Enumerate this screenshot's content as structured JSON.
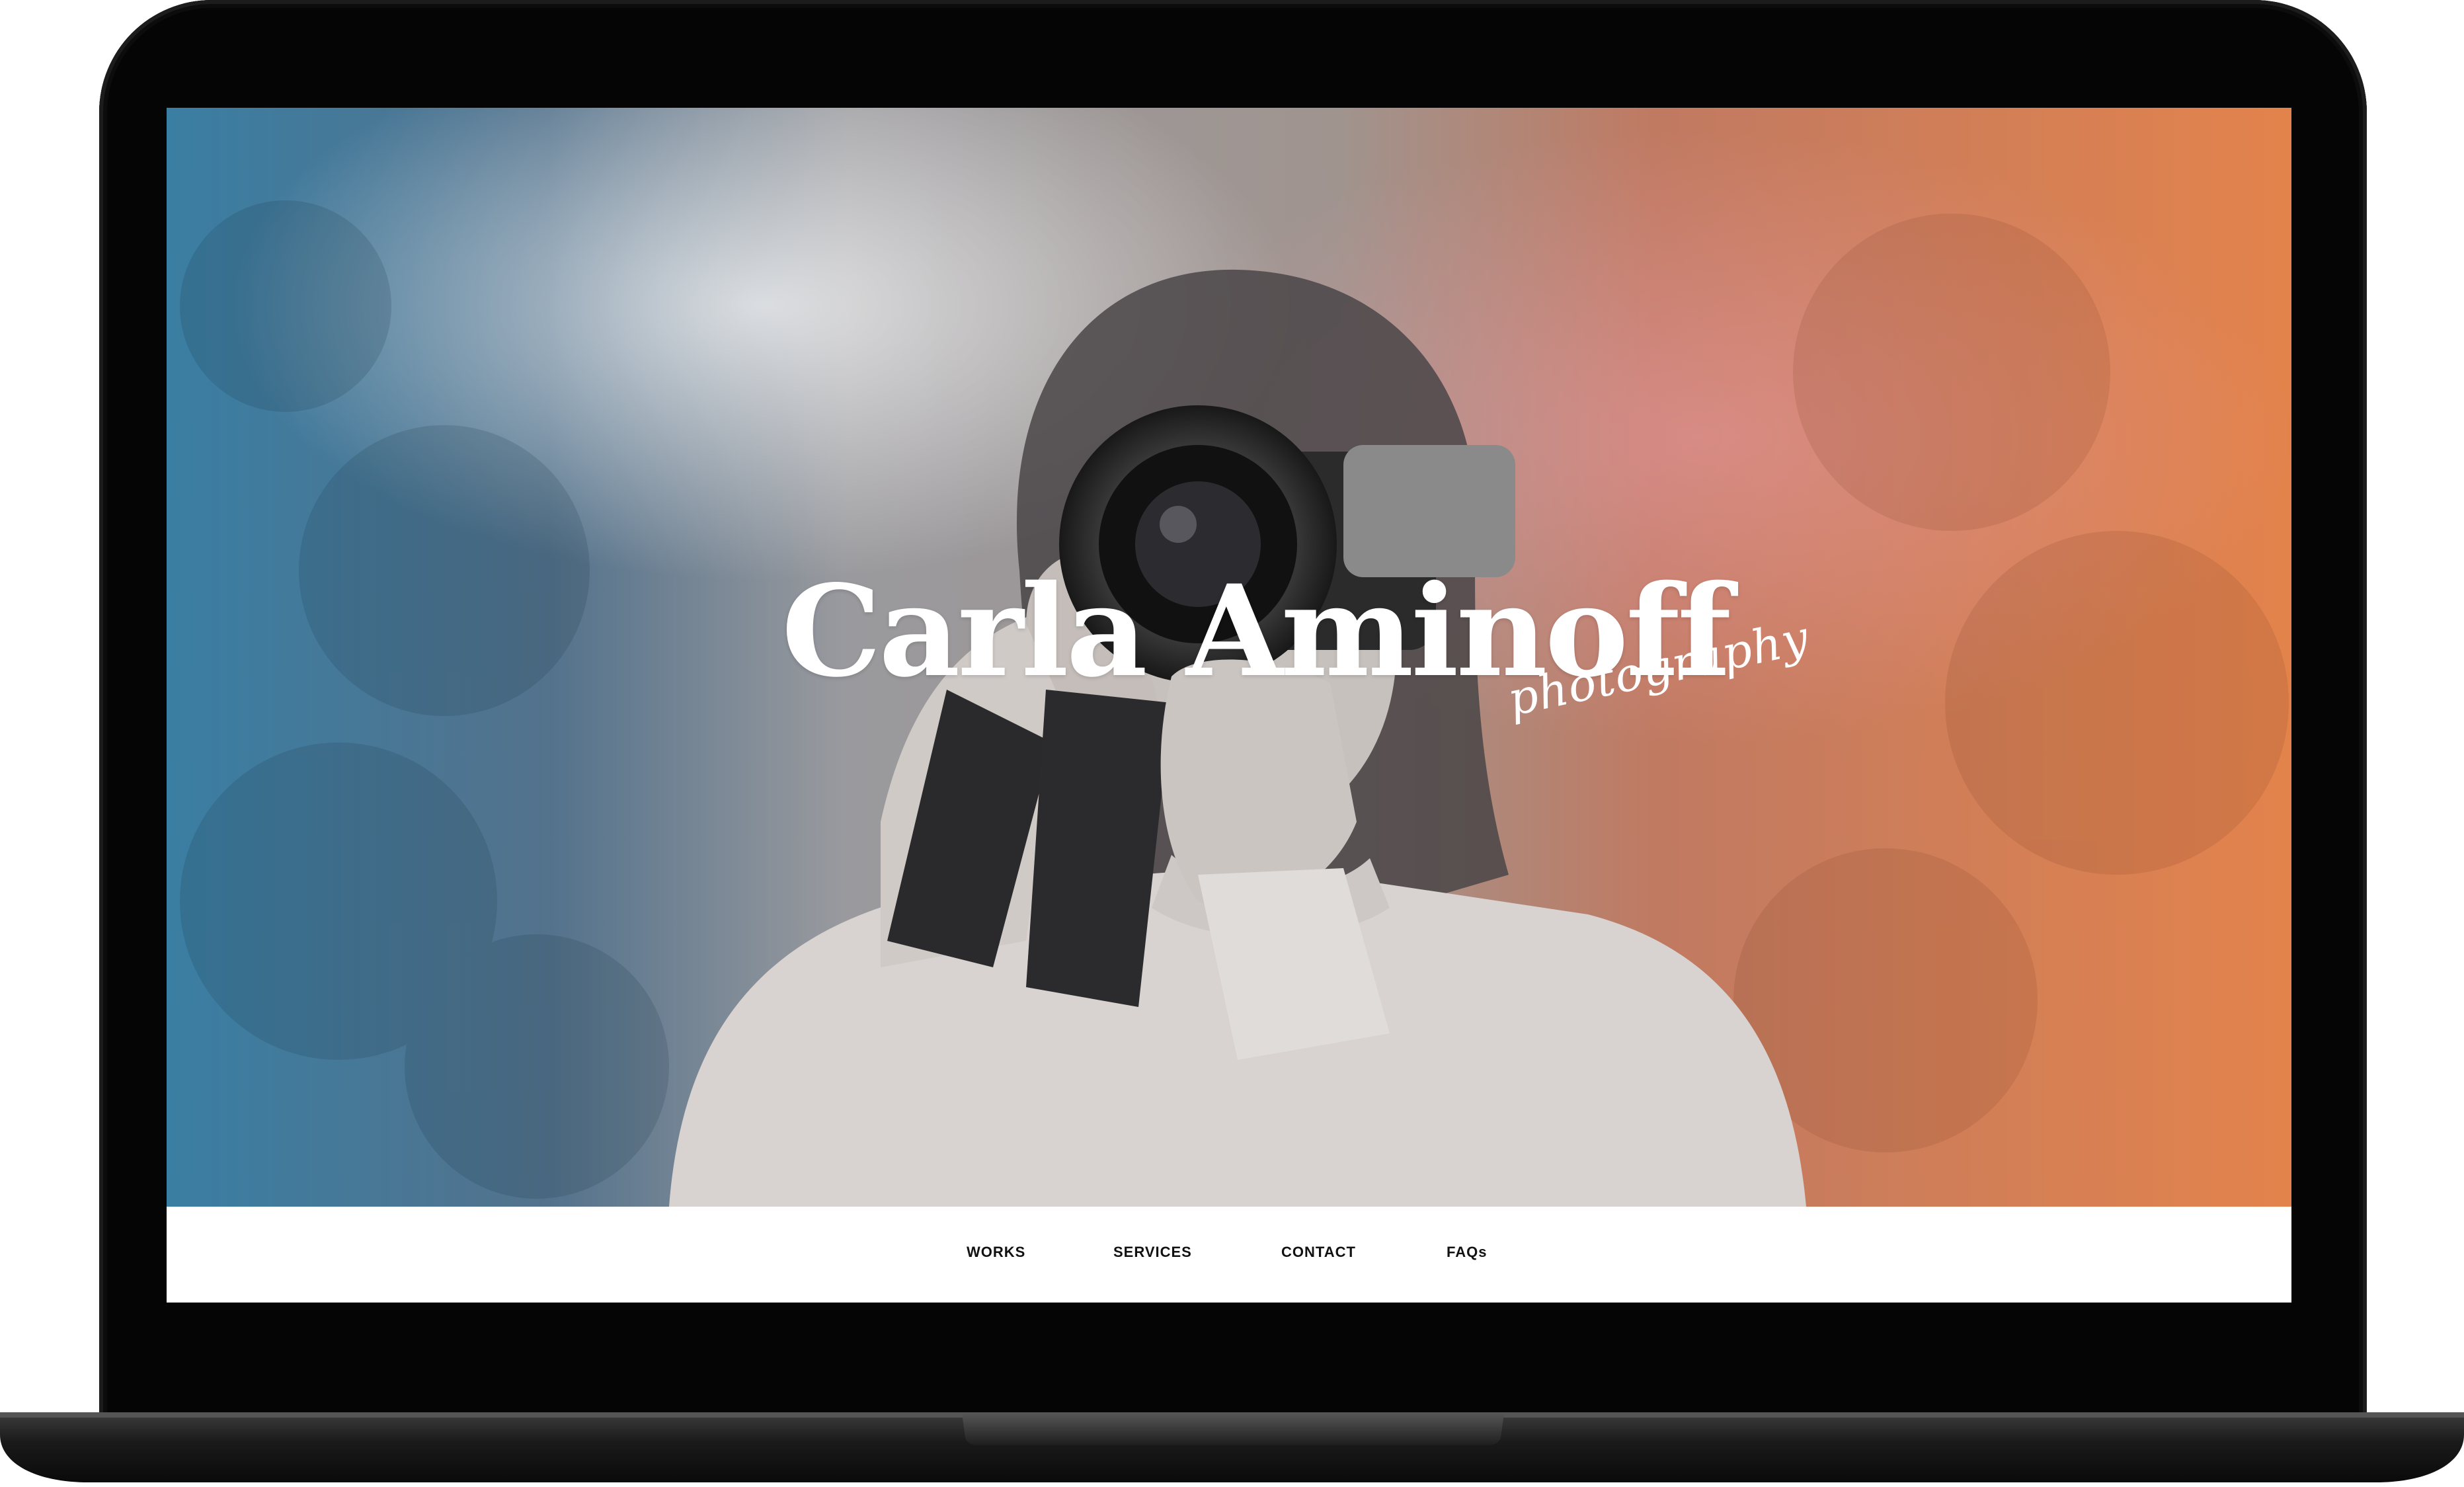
{
  "site": {
    "brand_name": "Carla Aminoff",
    "brand_tagline": "photography"
  },
  "nav": {
    "items": [
      {
        "label": "WORKS"
      },
      {
        "label": "SERVICES"
      },
      {
        "label": "CONTACT"
      },
      {
        "label": "FAQs"
      }
    ]
  },
  "hero": {
    "description": "Hero photo of a woman holding a Canon camera to her face, color graded blue to orange"
  },
  "colors": {
    "gradient_left": "#3a7ea3",
    "gradient_right": "#e8844a",
    "device_frame": "#050505"
  }
}
